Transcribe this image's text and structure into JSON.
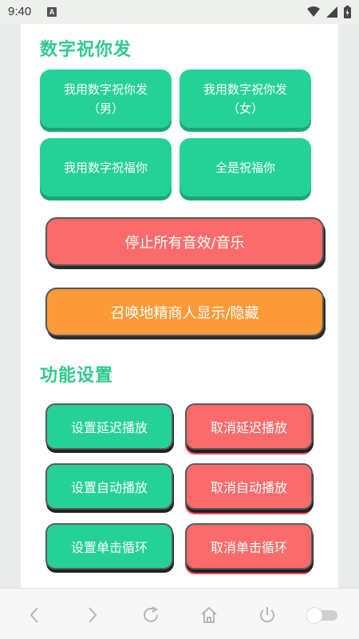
{
  "status_bar": {
    "time": "9:40",
    "indicator": "A",
    "icons": [
      "wifi-icon",
      "signal-icon",
      "battery-icon"
    ]
  },
  "section1": {
    "title": "数字祝你发",
    "buttons": [
      {
        "label": "我用数字祝你发\n（男）"
      },
      {
        "label": "我用数字祝你发\n（女）"
      },
      {
        "label": "我用数字祝福你"
      },
      {
        "label": "全是祝福你"
      }
    ],
    "stop_label": "停止所有音效/音乐",
    "summon_label": "召唤地精商人显示/隐藏"
  },
  "section2": {
    "title": "功能设置",
    "buttons": {
      "set_delay": "设置延迟播放",
      "cancel_delay": "取消延迟播放",
      "set_auto": "设置自动播放",
      "cancel_auto": "取消自动播放",
      "set_loop": "设置单击循环",
      "cancel_loop": "取消单击循环"
    }
  },
  "nav": {
    "icons": [
      "back-icon",
      "forward-icon",
      "refresh-icon",
      "home-icon",
      "power-icon",
      "toggle-switch"
    ]
  },
  "colors": {
    "accent_green": "#25d197",
    "title_green": "#2fc98f",
    "red": "#fc6b6b",
    "orange": "#fd9a38"
  }
}
